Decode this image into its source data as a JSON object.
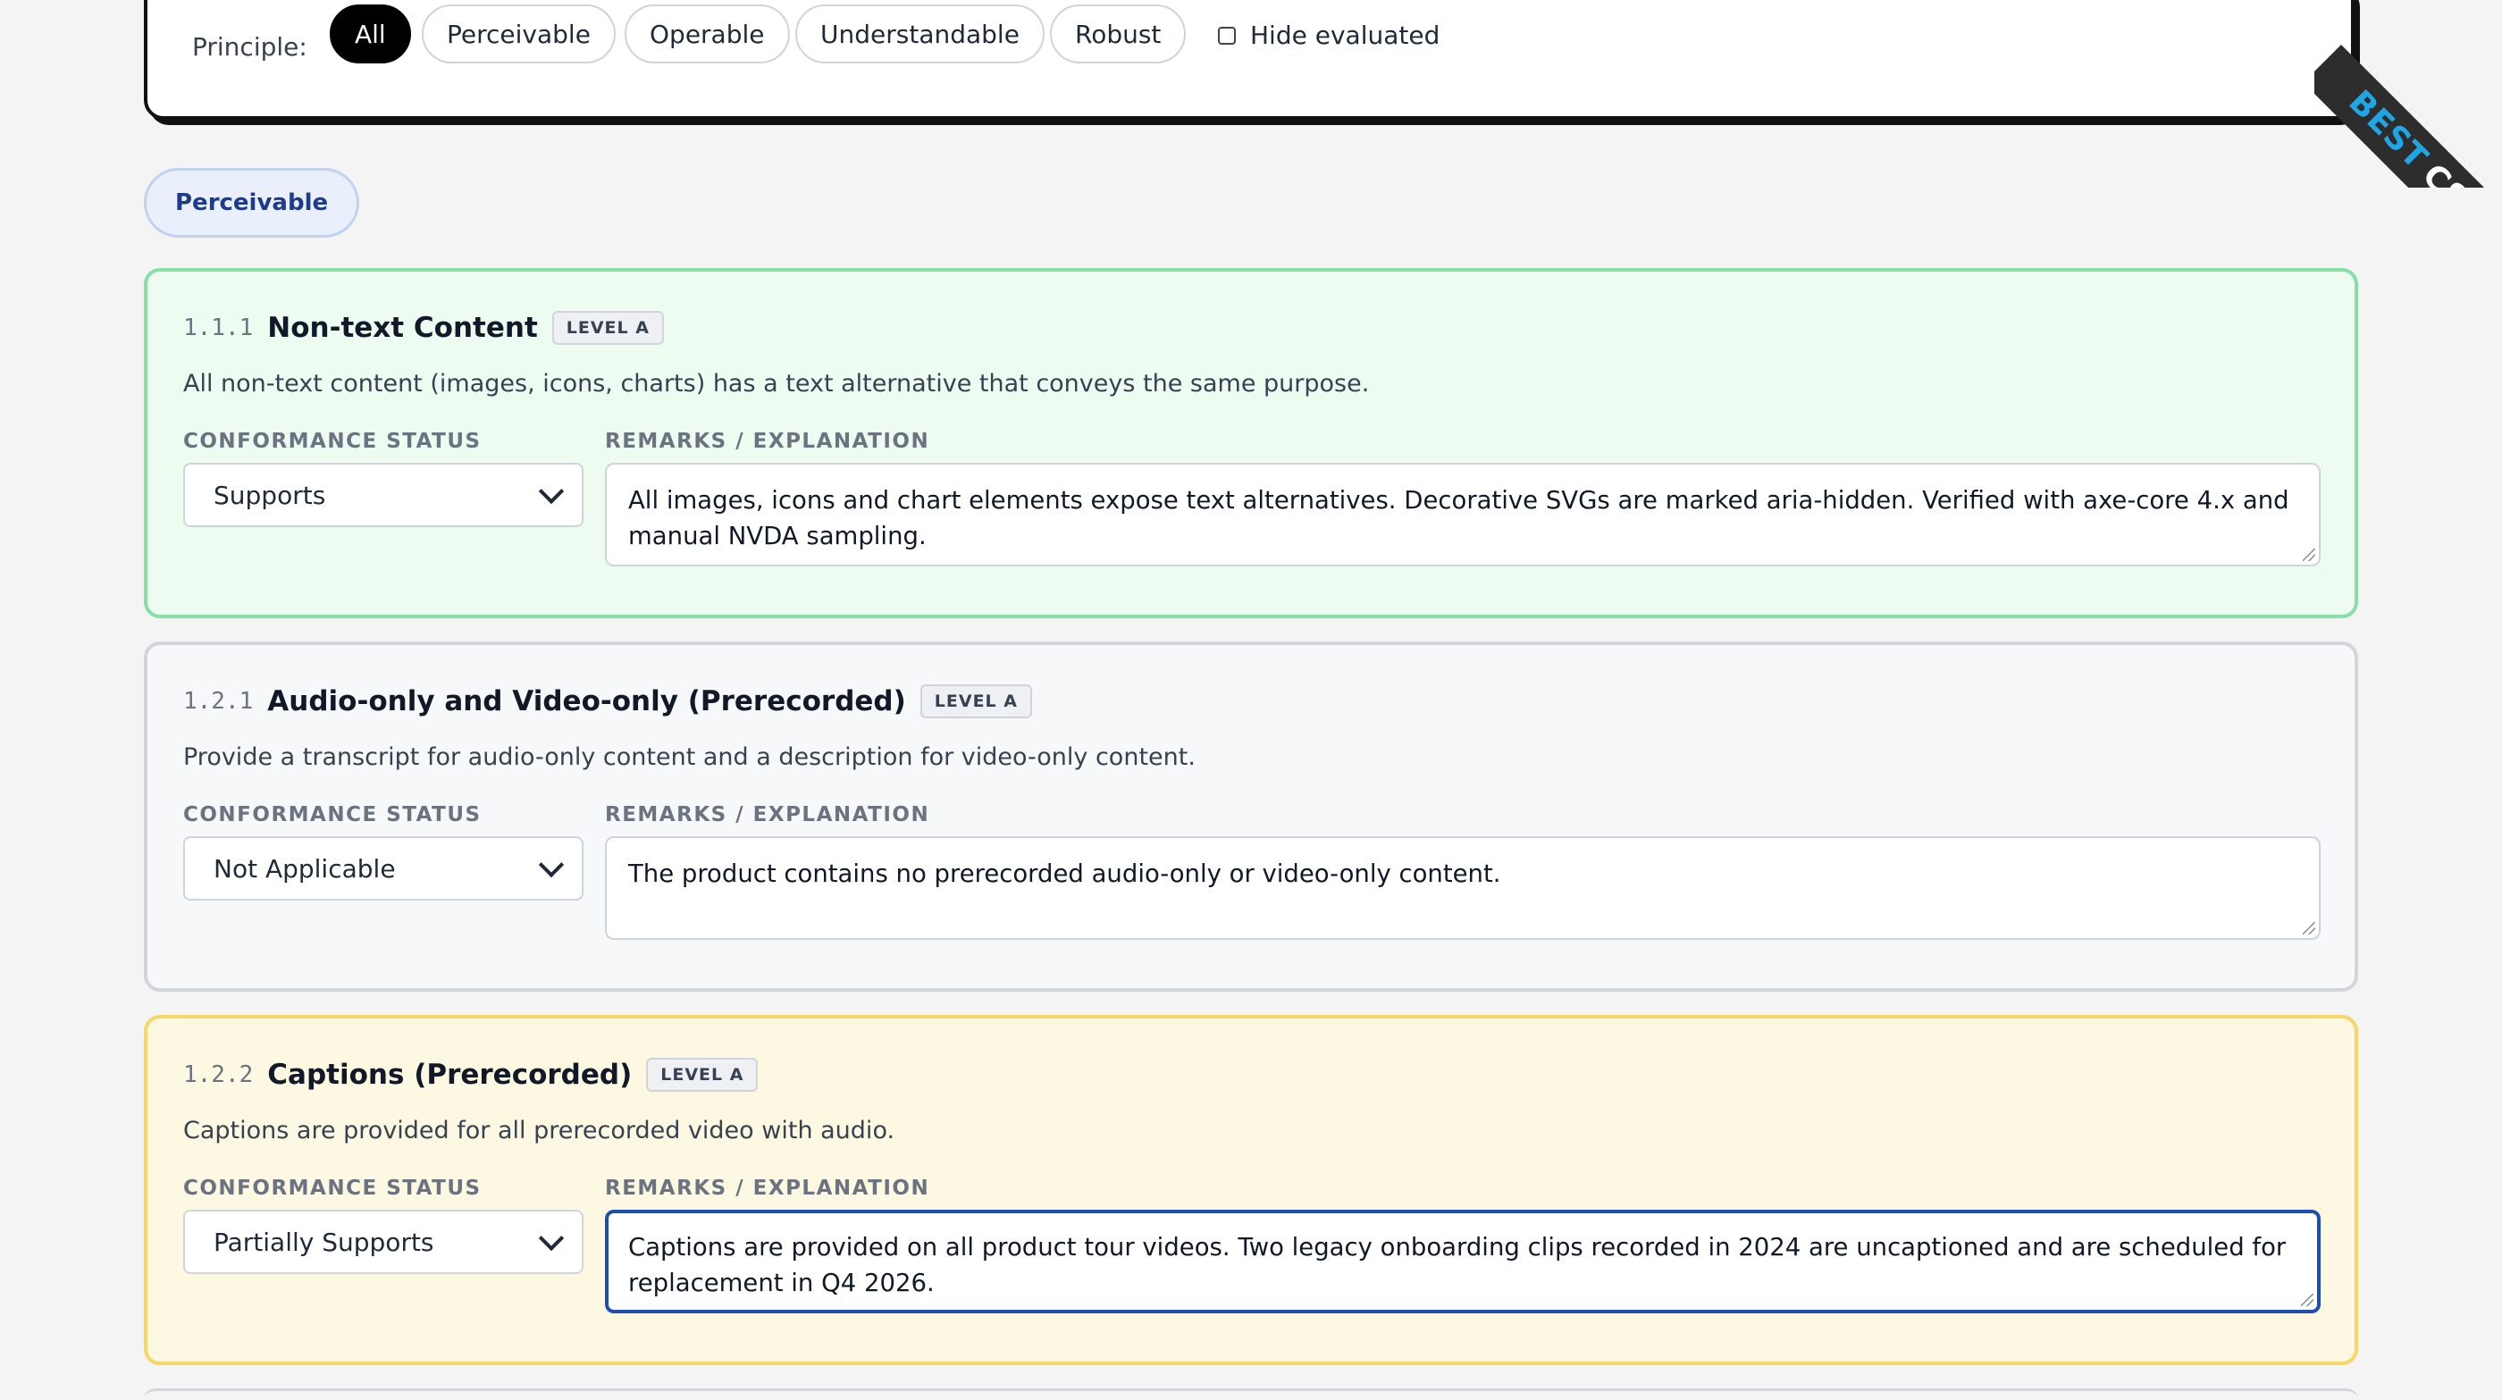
{
  "filter": {
    "principle_label": "Principle:",
    "pills": [
      "All",
      "Perceivable",
      "Operable",
      "Understandable",
      "Robust"
    ],
    "active": "All",
    "hide_evaluated_label": "Hide evaluated",
    "hide_evaluated_checked": false
  },
  "section": {
    "label": "Perceivable"
  },
  "field_labels": {
    "status": "CONFORMANCE STATUS",
    "remarks": "REMARKS / EXPLANATION"
  },
  "criteria": [
    {
      "number": "1.1.1",
      "title": "Non-text Content",
      "level": "LEVEL A",
      "description": "All non-text content (images, icons, charts) has a text alternative that conveys the same purpose.",
      "status": "Supports",
      "remarks": "All images, icons and chart elements expose text alternatives. Decorative SVGs are marked aria-hidden. Verified with axe-core 4.x and manual NVDA sampling."
    },
    {
      "number": "1.2.1",
      "title": "Audio-only and Video-only (Prerecorded)",
      "level": "LEVEL A",
      "description": "Provide a transcript for audio-only content and a description for video-only content.",
      "status": "Not Applicable",
      "remarks": "The product contains no prerecorded audio-only or video-only content."
    },
    {
      "number": "1.2.2",
      "title": "Captions (Prerecorded)",
      "level": "LEVEL A",
      "description": "Captions are provided for all prerecorded video with audio.",
      "status": "Partially Supports",
      "remarks": "Captions are provided on all product tour videos. Two legacy onboarding clips recorded in 2024 are uncaptioned and are scheduled for replacement in Q4 2026."
    }
  ],
  "ribbon": {
    "word1": "BEST",
    "word2": "CSS"
  },
  "colors": {
    "supports_border": "#86e0a6",
    "na_border": "#d2d6dc",
    "partial_border": "#f6d766",
    "focus_ring": "#1e4fb0",
    "ribbon_accent": "#1ea7e6"
  },
  "icons": {
    "status_dropdown": "chevron-down-icon",
    "ribbon": "corner-ribbon"
  }
}
